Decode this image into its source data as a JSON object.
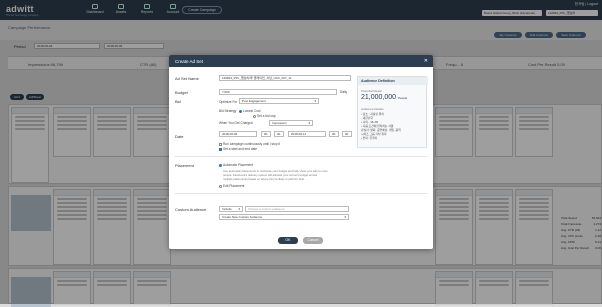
{
  "brand": {
    "name": "adwitt",
    "tagline": "The Ad Technology Company"
  },
  "nav": [
    {
      "label": "Dashboard"
    },
    {
      "label": "Assets"
    },
    {
      "label": "Reports"
    },
    {
      "label": "Account"
    }
  ],
  "create_campaign": "Create Campaign",
  "user": {
    "name": "한국팀",
    "logout": "Logout"
  },
  "top_selects": [
    "Brand Global Group_BGG (Facebook)",
    "120823_PPL_앱설치"
  ],
  "page": {
    "title": "Campaign Performance",
    "period_label": "Period"
  },
  "period": {
    "start": "2018-06-04",
    "end": "2018-06-06"
  },
  "buttons": {
    "my_columns": "My Columns",
    "edit_columns": "Edit Columns",
    "save_columns": "Save Columns"
  },
  "stats": {
    "impressions": "Impressions 98,799",
    "ctr": "CTR (All)",
    "cost_per_result": "Cost Per Result",
    "cost_per_result_val": "0.00",
    "freq": "Frequ...",
    "freq_val": "6"
  },
  "pills": {
    "a": "Grid",
    "b": "Ad/Sheet"
  },
  "right_table": [
    {
      "k": "Total Spend",
      "v": "53.924"
    },
    {
      "k": "Total Impressio..",
      "v": "2.274"
    },
    {
      "k": "Avg. CTR (All)",
      "v": "1.12"
    },
    {
      "k": "Avg. CPC (Link)",
      "v": "0.28"
    },
    {
      "k": "Avg. CPM",
      "v": "5.21"
    },
    {
      "k": "Avg. Cost Per Result",
      "v": "0.00"
    }
  ],
  "modal": {
    "title": "Create Ad Set",
    "adset_name_label": "Ad Set Name",
    "adset_name_value": "120823_PPL_앱설치/투 클레이언_서남_UAC_007_11",
    "budget_label": "Budget",
    "budget_value": "7,000",
    "budget_unit": "Daily",
    "bid_label": "Bid",
    "optimize_for_label": "Optimize For",
    "optimize_for_value": "Post Engagement",
    "bid_strategy_label": "Bid Strategy",
    "bid_strategy_value": "Lowest Cost",
    "bid_cap_label": "Set a bid cap",
    "when_charged_label": "When You Get Charged",
    "when_charged_value": "Impression",
    "date_label": "Date",
    "date_start": "2018-06-06",
    "time_h": "00",
    "time_m": "00",
    "date_end": "2018-06-11",
    "run_continuously": "Run campaign continuously until I stop it",
    "set_start_end": "Set a start and end date",
    "placement_label": "Placement",
    "auto_placement": "Automatic Placement",
    "auto_desc_1": "Use automatic placements to maximise your budget and help show your ads to more",
    "auto_desc_2": "people. Facebook's delivery system will allocate your ad set's budget across",
    "auto_desc_3": "multiple placements based on where they're likely to perform best.",
    "edit_placement": "Edit Placement",
    "custom_audience_label": "Custom Audience",
    "include_value": "Include",
    "ca_placeholder": "Choose a custom audience",
    "create_new_ca": "Create New Custom Audience",
    "audience": {
      "title": "Audience Definition",
      "reach_label": "Potential Reach",
      "reach_value": "21,000,000",
      "reach_unit": "People",
      "details_label": "Audience Details",
      "details": [
        "• 장소 : 지정된 위치",
        "- 대한민국",
        "• 나이 : 18~65",
        "• 다음 조건에 일치하는 사람",
        "관심사: 영화, 공연예술, 게임, 음악",
        "시리즈 그룹 기타 취미",
        "• 언어: 한국어"
      ]
    },
    "ok": "OK",
    "cancel": "Cancel"
  },
  "colors": {
    "navy": "#2d3e50",
    "accent": "#3b6fb6",
    "ok": "#2d3e50",
    "cancel": "#a8a8a8"
  }
}
